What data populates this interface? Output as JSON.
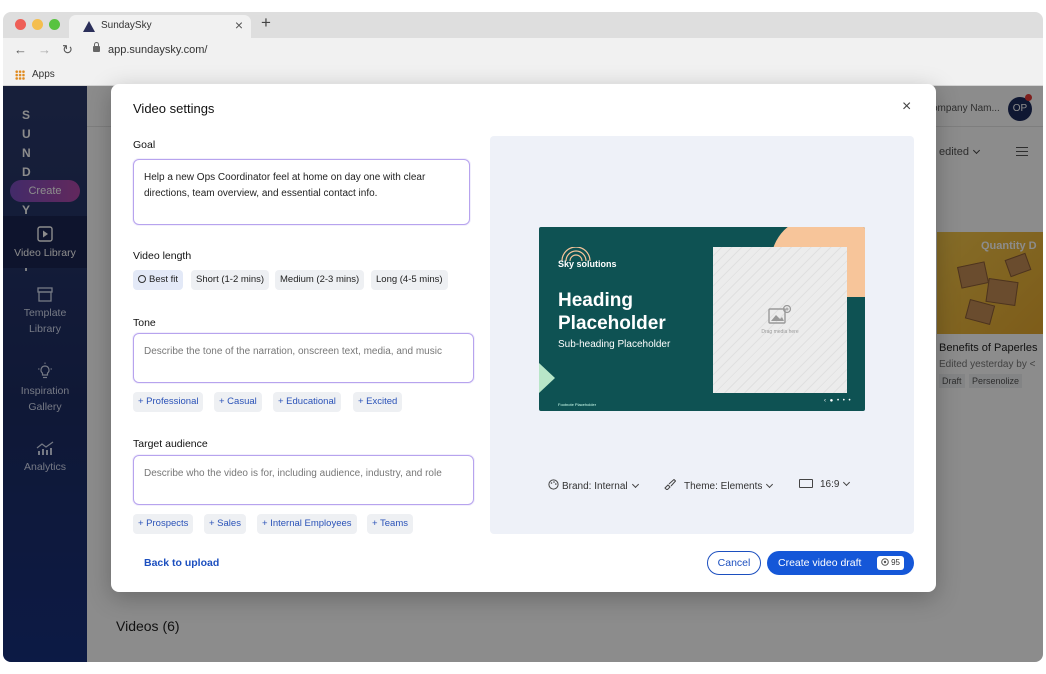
{
  "browser": {
    "tab_title": "SundaySky",
    "tab_close": "×",
    "new_tab": "+",
    "url": "app.sundaysky.com/",
    "bookmark": "Apps",
    "nav": {
      "back": "←",
      "forward": "→",
      "reload": "↻"
    }
  },
  "sidebar": {
    "logo": "SUNDAYSKY",
    "create_label": "Create",
    "items": [
      {
        "label": "Video Library",
        "icon": "play-icon"
      },
      {
        "label": "Template Library",
        "icon": "template-icon"
      },
      {
        "label": "Inspiration Gallery",
        "icon": "lightbulb-icon"
      },
      {
        "label": "Analytics",
        "icon": "analytics-icon"
      }
    ]
  },
  "header": {
    "company": "ompany Nam...",
    "avatar_initials": "OP",
    "sort_label": "edited"
  },
  "card": {
    "thumb_title": "Quantity D",
    "title": "Benefits of Paperles",
    "subtitle": "Edited yesterday by <",
    "status": "Draft",
    "tag": "Persenolize"
  },
  "videos_heading": "Videos (6)",
  "modal": {
    "title": "Video settings",
    "close": "×",
    "goal": {
      "label": "Goal",
      "value": "Help a new Ops Coordinator feel at home on day one with clear directions, team overview, and essential contact info."
    },
    "video_length": {
      "label": "Video length",
      "options": [
        "Best fit",
        "Short (1-2 mins)",
        "Medium (2-3 mins)",
        "Long (4-5 mins)"
      ],
      "selected": "Best fit"
    },
    "tone": {
      "label": "Tone",
      "placeholder": "Describe the tone of the narration, onscreen text, media, and music",
      "suggestions": [
        "+ Professional",
        "+ Casual",
        "+ Educational",
        "+ Excited"
      ]
    },
    "audience": {
      "label": "Target audience",
      "placeholder": "Describe who the video is for, including audience, industry, and role",
      "suggestions": [
        "+ Prospects",
        "+ Sales",
        "+ Internal Employees",
        "+ Teams"
      ]
    },
    "preview": {
      "brand_logo": "Sky solutions",
      "heading": "Heading Placeholder",
      "subheading": "Sub-heading Placeholder",
      "drag_media": "Drag media here",
      "footnote": "Footnote Placeholder",
      "brand": "Brand: Internal",
      "theme": "Theme: Elements",
      "aspect": "16:9"
    },
    "back_link": "Back to upload",
    "cancel_label": "Cancel",
    "create_label": "Create video draft",
    "credits": "95"
  },
  "colors": {
    "primary": "#1557d8",
    "sidebar": "#1d2d63",
    "slide_bg": "#0e5253",
    "slide_accent": "#f7c59a"
  }
}
